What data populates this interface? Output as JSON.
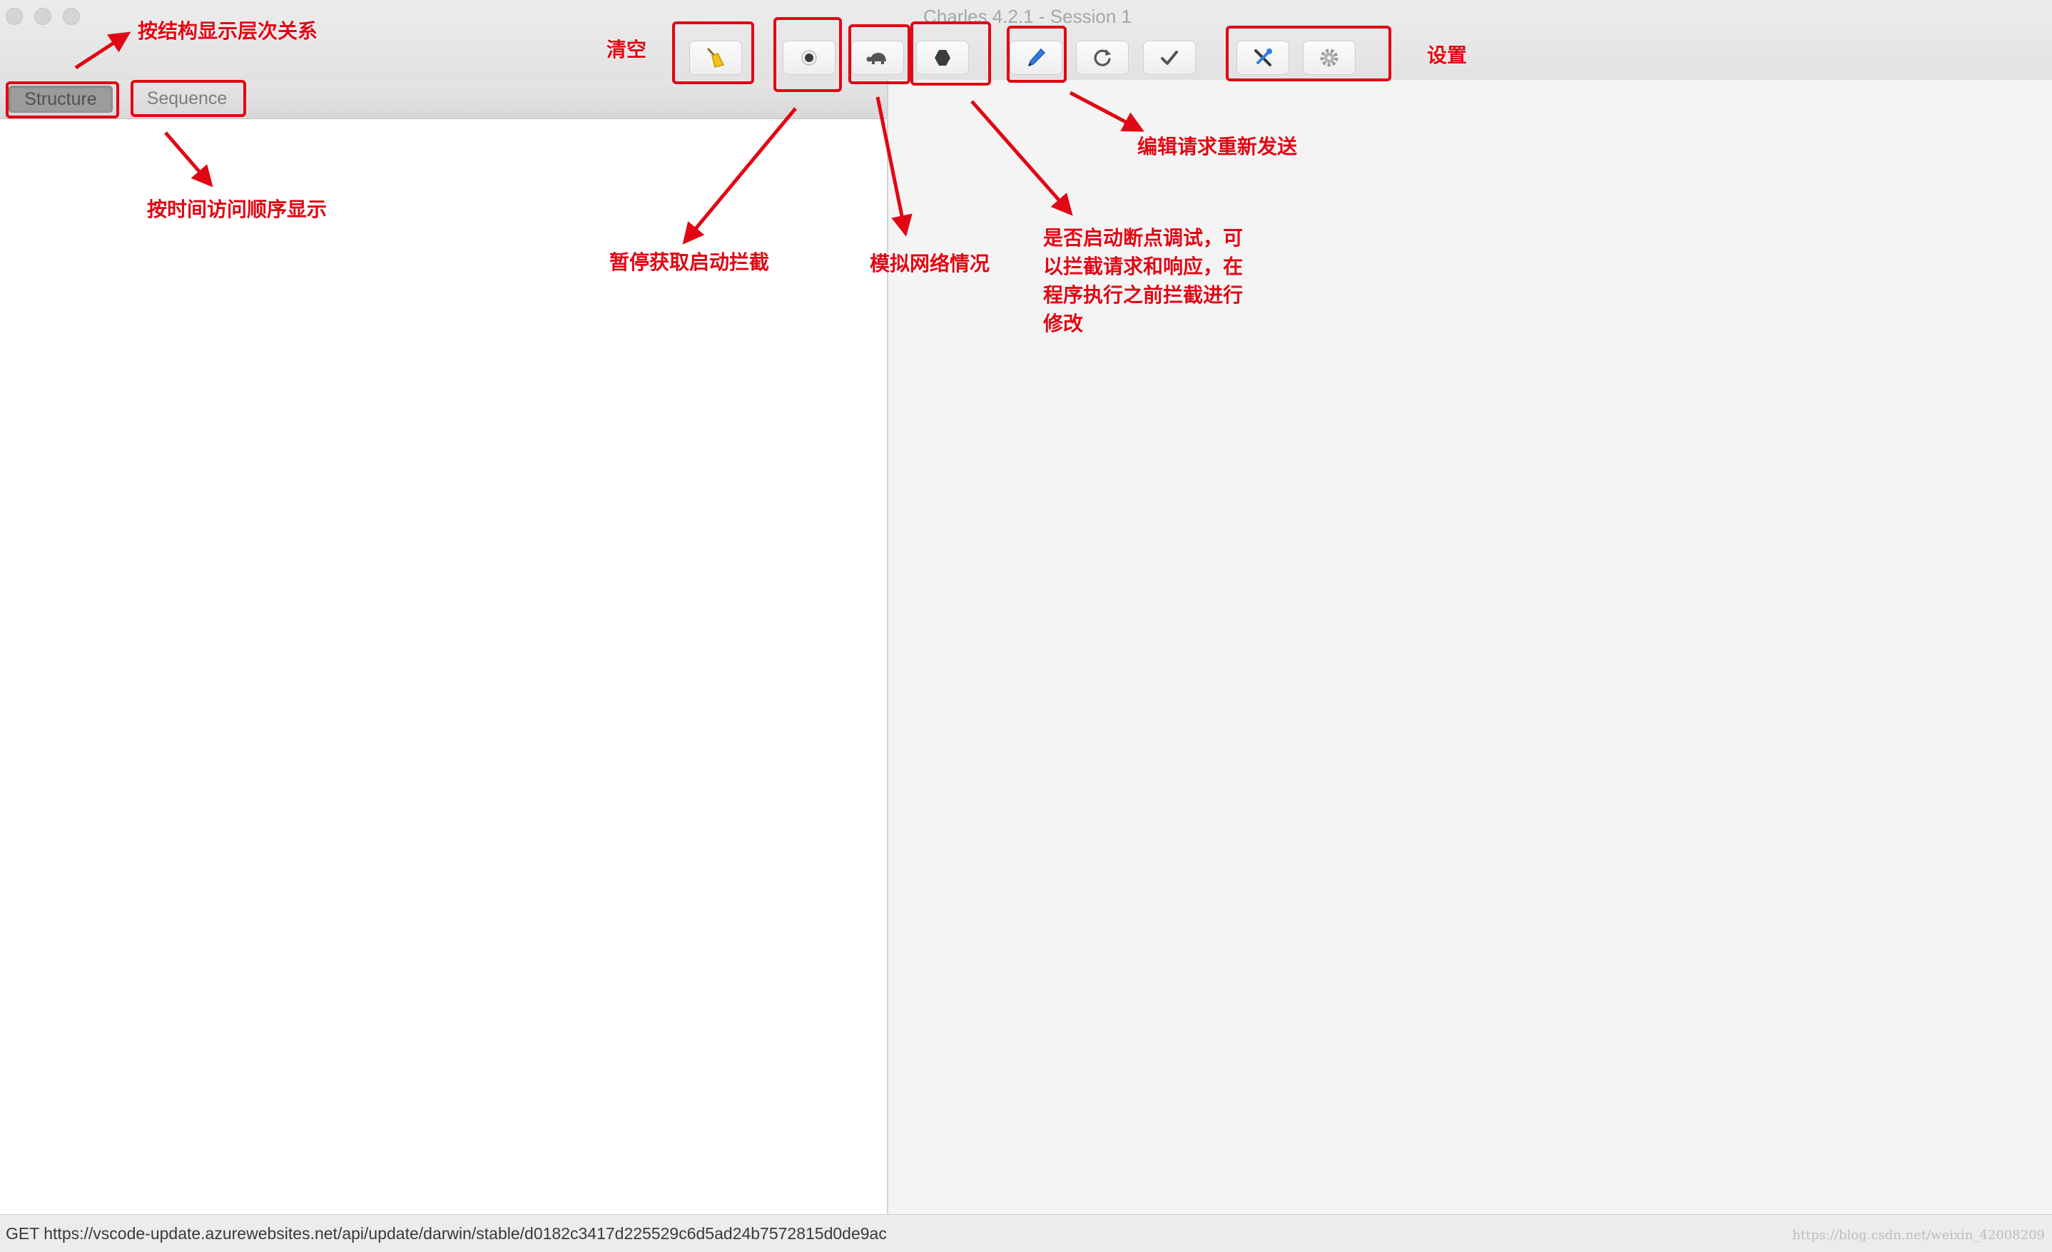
{
  "window": {
    "title": "Charles 4.2.1 - Session 1"
  },
  "toolbar": {
    "buttons": [
      {
        "name": "clear",
        "icon": "broom-icon"
      },
      {
        "name": "record",
        "icon": "record-icon"
      },
      {
        "name": "throttle",
        "icon": "turtle-icon"
      },
      {
        "name": "breakpoints",
        "icon": "stop-hexagon-icon"
      },
      {
        "name": "compose",
        "icon": "pen-icon"
      },
      {
        "name": "repeat",
        "icon": "refresh-icon"
      },
      {
        "name": "validate",
        "icon": "checkmark-icon"
      },
      {
        "name": "tools",
        "icon": "tools-icon"
      },
      {
        "name": "settings",
        "icon": "gear-icon"
      }
    ]
  },
  "tabs": {
    "structure": "Structure",
    "sequence": "Sequence"
  },
  "status": {
    "text": "GET https://vscode-update.azurewebsites.net/api/update/darwin/stable/d0182c3417d225529c6d5ad24b7572815d0de9ac",
    "watermark": "https://blog.csdn.net/weixin_42008209"
  },
  "annotations": {
    "structure_desc": "按结构显示层次关系",
    "sequence_desc": "按时间访问顺序显示",
    "clear": "清空",
    "record": "暂停获取启动拦截",
    "throttle": "模拟网络情况",
    "breakpoints": "是否启动断点调试，可以拦截请求和响应，在程序执行之前拦截进行修改",
    "compose": "编辑请求重新发送",
    "settings": "设置"
  },
  "colors": {
    "annotation": "#e10613",
    "pane_left": "#ffffff",
    "pane_right": "#f4f4f4"
  }
}
